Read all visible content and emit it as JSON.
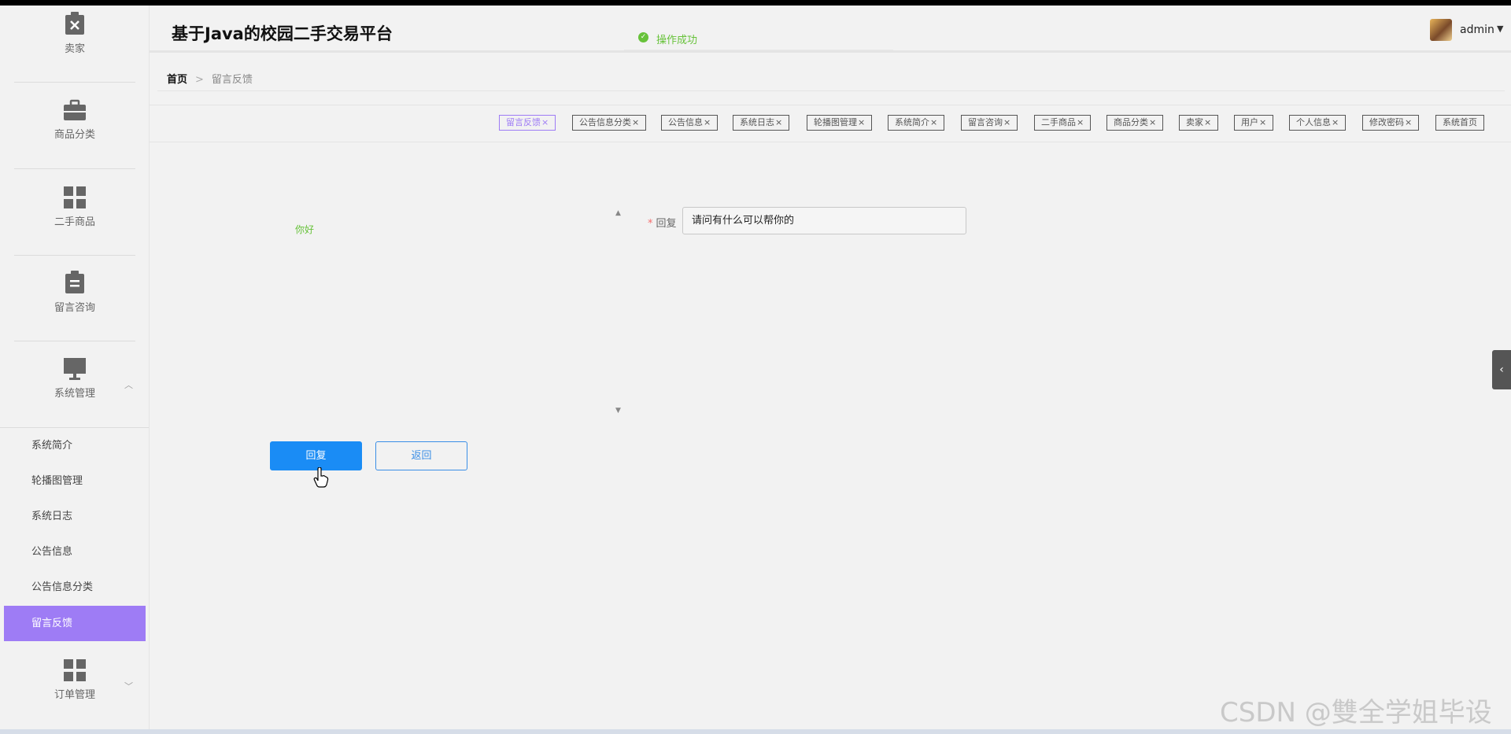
{
  "app": {
    "title": "基于Java的校园二手交易平台"
  },
  "toast": {
    "message": "操作成功"
  },
  "user": {
    "name": "admin"
  },
  "sidebar": {
    "items": [
      {
        "label": "卖家",
        "icon": "clipboard-x-icon"
      },
      {
        "label": "商品分类",
        "icon": "briefcase-icon"
      },
      {
        "label": "二手商品",
        "icon": "grid-icon"
      },
      {
        "label": "留言咨询",
        "icon": "clipboard-list-icon"
      },
      {
        "label": "系统管理",
        "icon": "monitor-icon"
      },
      {
        "label": "订单管理",
        "icon": "grid-icon"
      }
    ],
    "sub_items": [
      "系统简介",
      "轮播图管理",
      "系统日志",
      "公告信息",
      "公告信息分类",
      "留言反馈"
    ],
    "active_sub": "留言反馈"
  },
  "breadcrumb": {
    "home": "首页",
    "separator": ">",
    "current": "留言反馈"
  },
  "tags": [
    "留言反馈",
    "公告信息分类",
    "公告信息",
    "系统日志",
    "轮播图管理",
    "系统简介",
    "留言咨询",
    "二手商品",
    "商品分类",
    "卖家",
    "用户",
    "个人信息",
    "修改密码",
    "系统首页"
  ],
  "tag_close": "×",
  "form": {
    "message_text": "你好",
    "reply_label": "回复",
    "required_mark": "*",
    "reply_value": "请问有什么可以帮你的"
  },
  "buttons": {
    "reply": "回复",
    "back": "返回"
  },
  "watermark": "CSDN @雙全学姐毕设",
  "colors": {
    "accent": "#9e7cf5",
    "primary": "#1a8cf5",
    "success": "#67c23a"
  }
}
